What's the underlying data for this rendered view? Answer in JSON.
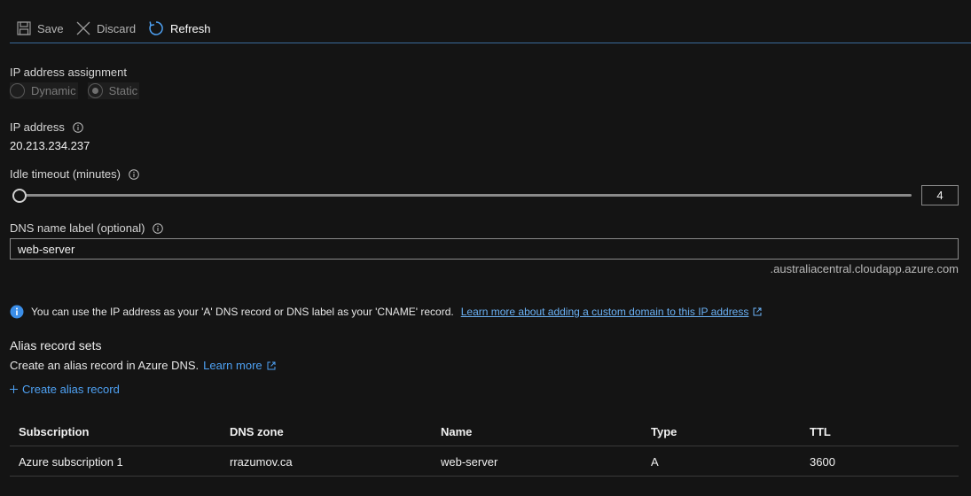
{
  "toolbar": {
    "save_label": "Save",
    "discard_label": "Discard",
    "refresh_label": "Refresh"
  },
  "ip_assignment": {
    "label": "IP address assignment",
    "options": [
      "Dynamic",
      "Static"
    ],
    "selected": "Static"
  },
  "ip_address": {
    "label": "IP address",
    "value": "20.213.234.237"
  },
  "idle_timeout": {
    "label": "Idle timeout (minutes)",
    "value": "4"
  },
  "dns_label": {
    "label": "DNS name label (optional)",
    "value": "web-server",
    "suffix": ".australiacentral.cloudapp.azure.com"
  },
  "info_banner": {
    "text": "You can use the IP address as your 'A' DNS record or DNS label as your 'CNAME' record.",
    "link": "Learn more about adding a custom domain to this IP address"
  },
  "alias": {
    "title": "Alias record sets",
    "description": "Create an alias record in Azure DNS.",
    "learn_more": "Learn more",
    "create_label": "Create alias record"
  },
  "table": {
    "columns": [
      "Subscription",
      "DNS zone",
      "Name",
      "Type",
      "TTL"
    ],
    "rows": [
      [
        "Azure subscription 1",
        "rrazumov.ca",
        "web-server",
        "A",
        "3600"
      ]
    ]
  },
  "colors": {
    "accent": "#4ea1f3",
    "background": "#141414"
  }
}
